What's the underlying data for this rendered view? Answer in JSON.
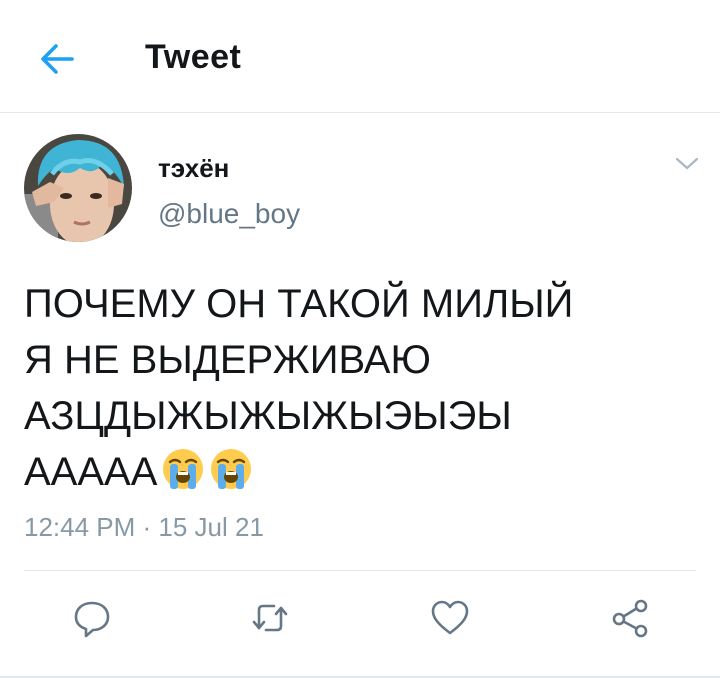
{
  "header": {
    "title": "Tweet",
    "back_icon": "arrow-left-icon",
    "accent_color": "#1da1f2"
  },
  "tweet": {
    "author": {
      "display_name": "тэхён",
      "handle": "@blue_boy"
    },
    "text_lines": [
      "ПОЧЕМУ ОН ТАКОЙ МИЛЫЙ",
      "Я НЕ ВЫДЕРЖИВАЮ",
      "АЗЦДЫЖЫЖЫЖЫЭЫЭЫ",
      "ААААА"
    ],
    "emojis": [
      "loudly-crying-face-icon",
      "loudly-crying-face-icon"
    ],
    "timestamp": "12:44 PM · 15 Jul 21"
  },
  "actions": [
    "reply-icon",
    "retweet-icon",
    "like-icon",
    "share-icon"
  ],
  "colors": {
    "text": "#14171a",
    "secondary": "#657786",
    "muted": "#8899a6",
    "divider": "#e1e8ed"
  }
}
